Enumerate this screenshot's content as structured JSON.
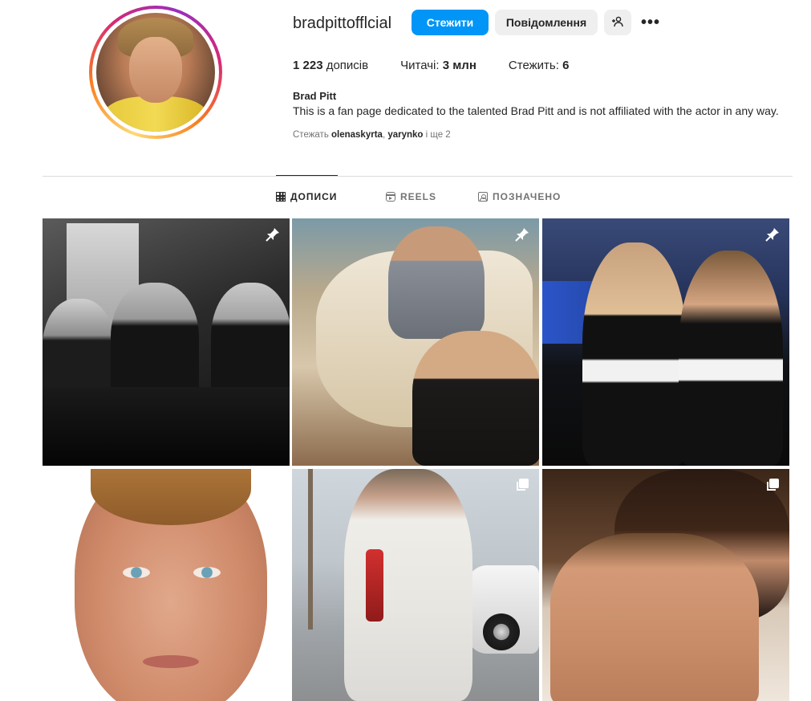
{
  "profile": {
    "username": "bradpittofflcial",
    "full_name": "Brad Pitt",
    "bio": "This is a fan page dedicated to the talented Brad Pitt and is not affiliated with the actor in any way.",
    "followed_by_prefix": "Стежать ",
    "followed_by_user1": "olenaskyrta",
    "followed_by_separator": ", ",
    "followed_by_user2": "yarynko",
    "followed_by_suffix": " і ще 2"
  },
  "actions": {
    "follow_label": "Стежити",
    "message_label": "Повідомлення",
    "more_label": "•••"
  },
  "stats": {
    "posts_value": "1 223",
    "posts_label": " дописів",
    "followers_label": "Читачі: ",
    "followers_value": "3 млн",
    "following_label": "Стежить: ",
    "following_value": "6"
  },
  "tabs": [
    {
      "label": "ДОПИСИ",
      "active": true
    },
    {
      "label": "REELS",
      "active": false
    },
    {
      "label": "ПОЗНАЧЕНО",
      "active": false
    }
  ],
  "posts": [
    {
      "badge": "pin-icon"
    },
    {
      "badge": "pin-icon"
    },
    {
      "badge": "pin-icon"
    },
    {
      "badge": "carousel-icon"
    },
    {
      "badge": "carousel-icon"
    },
    {
      "badge": "carousel-icon"
    }
  ],
  "colors": {
    "accent": "#0095f6",
    "secondary_button": "#efefef",
    "text": "#262626",
    "muted_text": "#737373",
    "divider": "#dbdbdb"
  }
}
